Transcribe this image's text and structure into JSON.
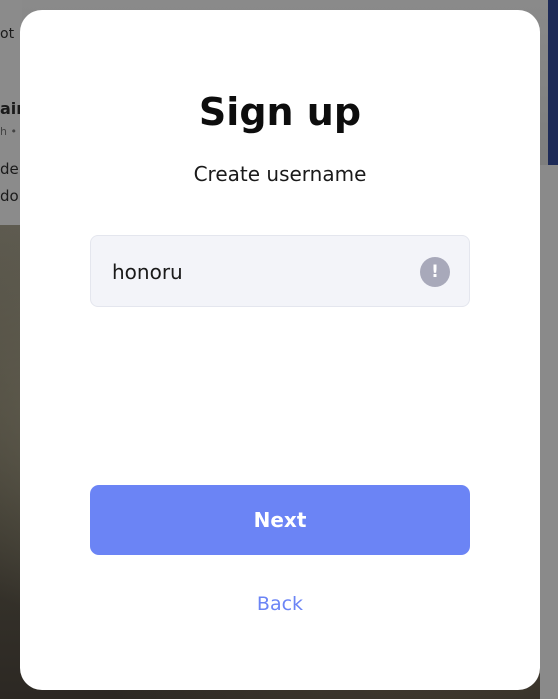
{
  "background": {
    "fragments": [
      "ot",
      "aim",
      "h •",
      "der",
      "dob"
    ]
  },
  "modal": {
    "title": "Sign up",
    "subtitle": "Create username",
    "username_value": "honoru",
    "warning_icon": "exclamation-icon",
    "warning_glyph": "!",
    "next_label": "Next",
    "back_label": "Back"
  },
  "colors": {
    "accent": "#6b84f5",
    "input_bg": "#f3f4f9",
    "warning_icon_bg": "#a8a9ba"
  }
}
